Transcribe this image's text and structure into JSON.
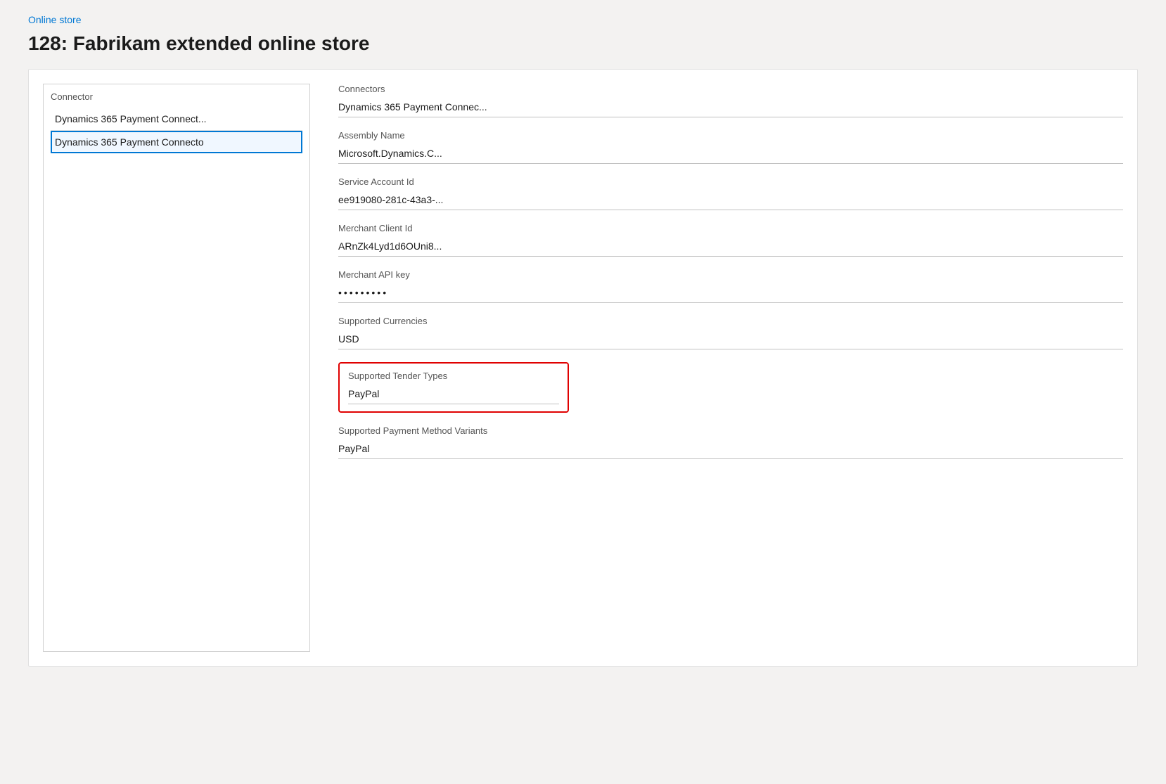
{
  "breadcrumb": {
    "label": "Online store",
    "href": "#"
  },
  "page": {
    "title": "128: Fabrikam extended online store"
  },
  "left_panel": {
    "label": "Connector",
    "items": [
      {
        "text": "Dynamics 365 Payment Connect...",
        "selected": false
      },
      {
        "text": "Dynamics 365 Payment Connecto",
        "selected": true
      }
    ]
  },
  "right_panel": {
    "fields": [
      {
        "label": "Connectors",
        "value": "Dynamics 365 Payment Connec...",
        "type": "text"
      },
      {
        "label": "Assembly Name",
        "value": "Microsoft.Dynamics.C...",
        "type": "text"
      },
      {
        "label": "Service Account Id",
        "value": "ee919080-281c-43a3-...",
        "type": "text"
      },
      {
        "label": "Merchant Client Id",
        "value": "ARnZk4Lyd1d6OUni8...",
        "type": "text"
      },
      {
        "label": "Merchant API key",
        "value": "•••••••••",
        "type": "password"
      },
      {
        "label": "Supported Currencies",
        "value": "USD",
        "type": "text"
      },
      {
        "label": "Supported Tender Types",
        "value": "PayPal",
        "type": "text",
        "highlighted": true
      },
      {
        "label": "Supported Payment Method Variants",
        "value": "PayPal",
        "type": "text"
      }
    ]
  }
}
